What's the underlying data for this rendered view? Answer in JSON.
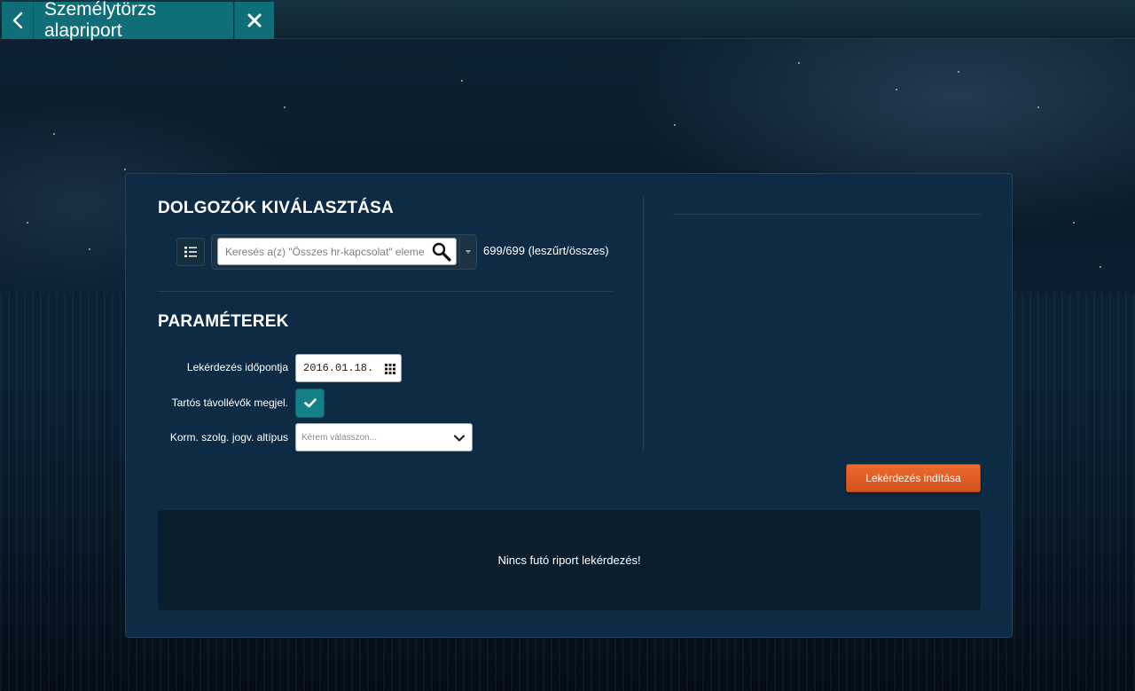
{
  "header": {
    "title": "Személytörzs alapriport"
  },
  "employee_selection": {
    "title": "DOLGOZÓK KIVÁLASZTÁSA",
    "search_placeholder": "Keresés a(z) \"Összes hr-kapcsolat\" eleme",
    "count_text": "699/699 (leszűrt/összes)"
  },
  "parameters": {
    "title": "PARAMÉTEREK",
    "query_date_label": "Lekérdezés időpontja",
    "query_date_value": "2016.01.18.",
    "long_absence_label": "Tartós távollévők megjel.",
    "long_absence_checked": true,
    "subtype_label": "Korm. szolg. jogv. altípus",
    "subtype_placeholder": "Kérem válasszon..."
  },
  "actions": {
    "run_label": "Lekérdezés indítása"
  },
  "status": {
    "message": "Nincs futó riport lekérdezés!"
  },
  "colors": {
    "accent_teal": "#0f6e78",
    "panel_bg": "#0d2b44",
    "run_button": "#e0602a"
  },
  "icons": {
    "back": "chevron-left-icon",
    "close": "close-icon",
    "list": "list-icon",
    "search": "search-icon",
    "dropdown": "caret-down-icon",
    "calendar": "calendar-icon",
    "check": "checkmark-icon",
    "select": "chevron-down-icon"
  }
}
